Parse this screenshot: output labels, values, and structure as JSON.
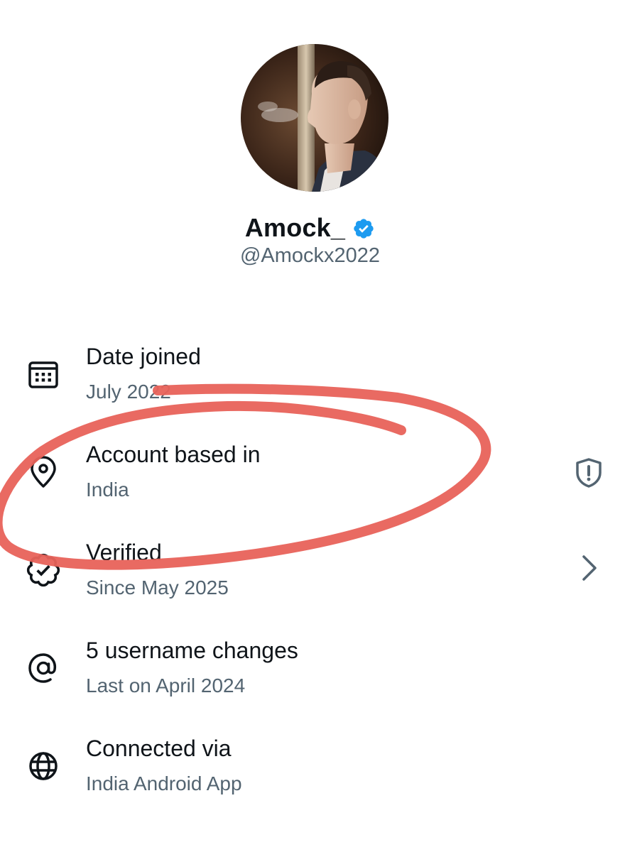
{
  "profile": {
    "display_name": "Amock_",
    "handle": "@Amockx2022",
    "verified": true
  },
  "info_rows": [
    {
      "title": "Date joined",
      "subtitle": "July 2022",
      "icon": "calendar-icon"
    },
    {
      "title": "Account based in",
      "subtitle": "India",
      "icon": "location-pin-icon",
      "trailing_icon": "shield-alert-icon"
    },
    {
      "title": "Verified",
      "subtitle": "Since May 2025",
      "icon": "verified-badge-outline-icon",
      "trailing_icon": "chevron-right-icon"
    },
    {
      "title": "5 username changes",
      "subtitle": "Last on April 2024",
      "icon": "at-sign-icon"
    },
    {
      "title": "Connected via",
      "subtitle": "India Android App",
      "icon": "globe-icon"
    }
  ],
  "colors": {
    "text_primary": "#0f1419",
    "text_secondary": "#536471",
    "verified_blue": "#1d9bf0",
    "annotation_red": "#e8625a"
  }
}
